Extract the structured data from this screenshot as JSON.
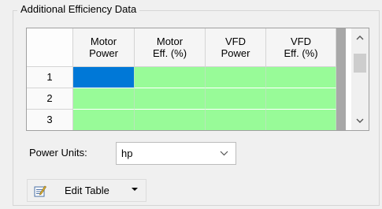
{
  "group": {
    "title": "Additional Efficiency Data"
  },
  "table": {
    "columns": [
      "Motor\nPower",
      "Motor\nEff. (%)",
      "VFD\nPower",
      "VFD\nEff. (%)"
    ],
    "rows": [
      "1",
      "2",
      "3"
    ],
    "selected_cell": {
      "row": 1,
      "column": 1
    }
  },
  "scroll": {
    "up_icon": "chevron-up-icon",
    "down_icon": "chevron-down-icon"
  },
  "power_units": {
    "label": "Power Units:",
    "value": "hp"
  },
  "edit_table": {
    "label": "Edit Table",
    "icon": "edit-table-icon"
  },
  "colors": {
    "data_cell": "#98fb98",
    "selected_cell": "#0078d7",
    "window_bg": "#f0f0f0"
  }
}
